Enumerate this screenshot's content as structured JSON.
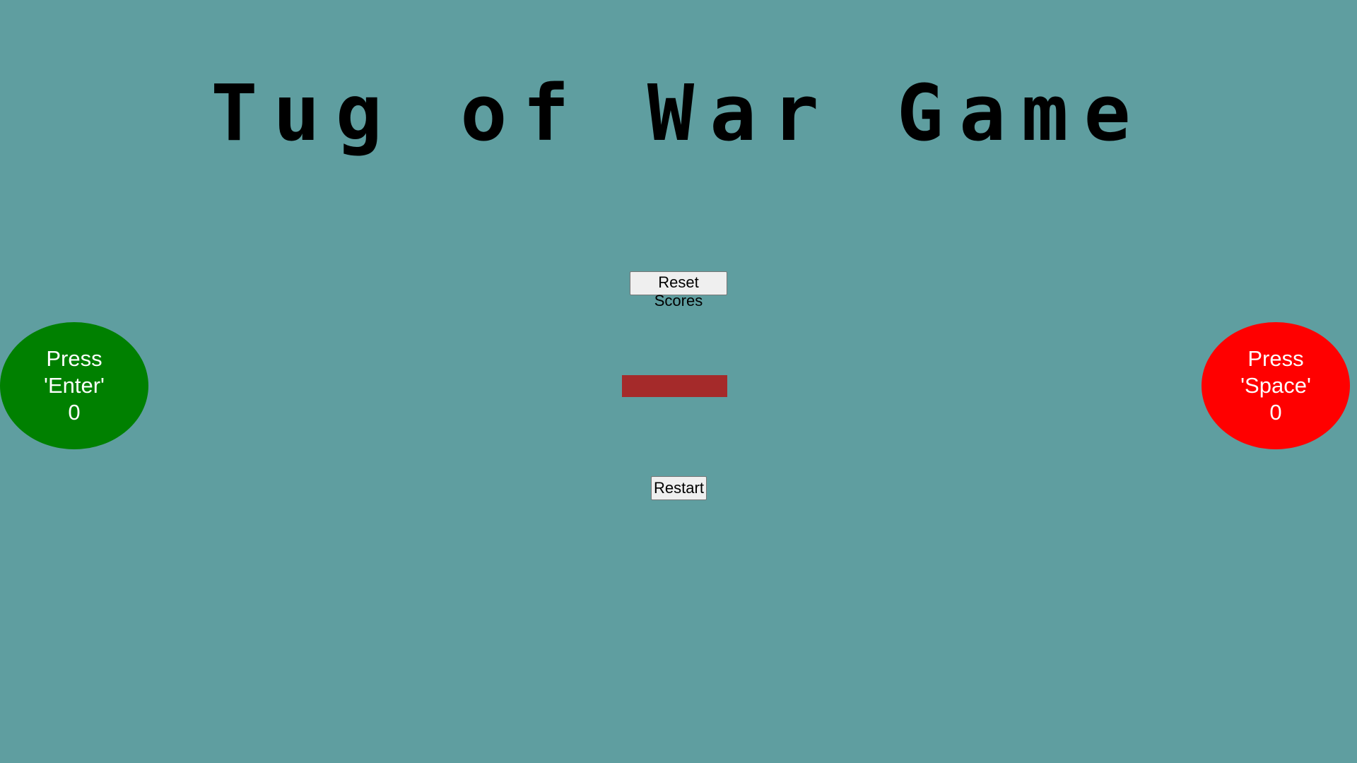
{
  "title": "Tug of War Game",
  "buttons": {
    "reset_label": "Reset Scores",
    "restart_label": "Restart"
  },
  "players": {
    "left": {
      "line1": "Press",
      "line2": "'Enter'",
      "score": "0",
      "color": "#008000"
    },
    "right": {
      "line1": "Press",
      "line2": "'Space'",
      "score": "0",
      "color": "#ff0000"
    }
  },
  "colors": {
    "background": "#5f9ea0",
    "rope": "#a52a2a",
    "title": "#000000"
  }
}
